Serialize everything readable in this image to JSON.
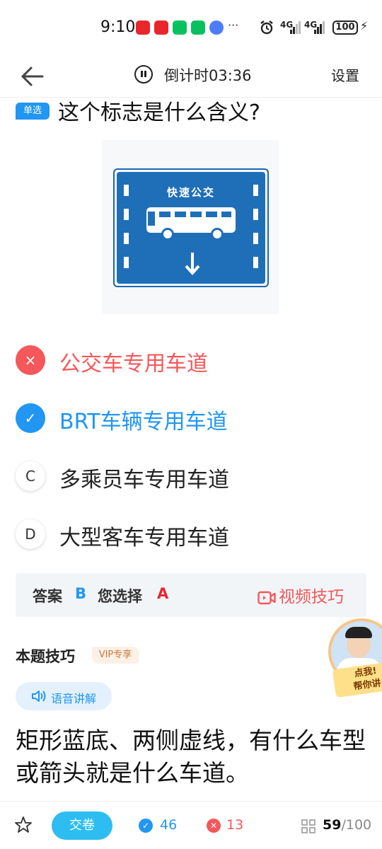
{
  "status_bar": {
    "time": "9:10",
    "more": "···",
    "signal1": "4G",
    "signal2": "4G",
    "battery": "100"
  },
  "nav": {
    "countdown": "倒计时03:36",
    "settings": "设置"
  },
  "question": {
    "type_tag": "单选",
    "text": "这个标志是什么含义?"
  },
  "sign": {
    "title": "快速公交"
  },
  "options": [
    {
      "letter": "×",
      "text": "公交车专用车道",
      "state": "wrong"
    },
    {
      "letter": "✓",
      "text": "BRT车辆专用车道",
      "state": "correct"
    },
    {
      "letter": "C",
      "text": "多乘员车专用车道",
      "state": "plain"
    },
    {
      "letter": "D",
      "text": "大型客车专用车道",
      "state": "plain"
    }
  ],
  "answer": {
    "answer_label": "答案",
    "answer_value": "B",
    "chosen_label": "您选择",
    "chosen_value": "A",
    "video_tip": "视频技巧"
  },
  "tip": {
    "title": "本题技巧",
    "vip": "VIP专享",
    "voice": "语音讲解",
    "body": "矩形蓝底、两侧虚线，有什么车型或箭头就是什么车道。"
  },
  "teacher": {
    "line1": "点我!",
    "line2": "帮你讲"
  },
  "bottom": {
    "submit": "交卷",
    "correct_count": "46",
    "wrong_count": "13",
    "current": "59",
    "total": "/100"
  },
  "colors": {
    "primary": "#2196f3",
    "wrong": "#f4585a",
    "submit": "#2dbdf0"
  }
}
